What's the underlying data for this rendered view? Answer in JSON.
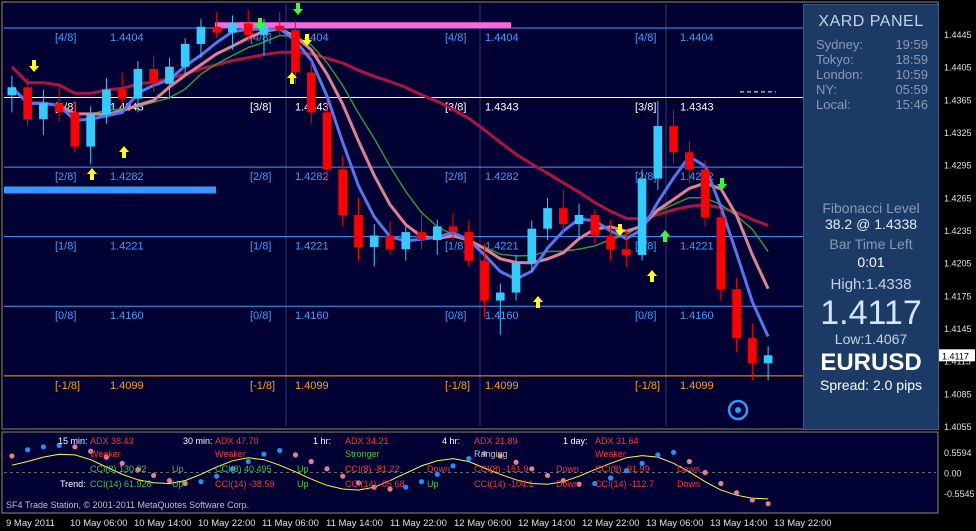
{
  "chart_data": {
    "type": "candlestick",
    "symbol": "EURUSD",
    "ylim": [
      1.4055,
      1.4425
    ],
    "y_ticks": [
      "1.4445",
      "1.4405",
      "1.4365",
      "1.4325",
      "1.4295",
      "1.4265",
      "1.4235",
      "1.4205",
      "1.4175",
      "1.4145",
      "1.4115",
      "1.4085",
      "1.4055"
    ],
    "current_price_label": "1.4117",
    "x_labels": [
      "9 May 2011",
      "10 May 06:00",
      "10 May 14:00",
      "10 May 22:00",
      "11 May 06:00",
      "11 May 14:00",
      "11 May 22:00",
      "12 May 06:00",
      "12 May 14:00",
      "12 May 22:00",
      "13 May 06:00",
      "13 May 14:00",
      "13 May 22:00"
    ],
    "murrey_levels": [
      {
        "name": "[4/8]",
        "value": 1.4404,
        "label": "1.4404",
        "color": "#3aa0ff"
      },
      {
        "name": "[3/8]",
        "value": 1.4343,
        "label": "1.4343",
        "color": "#ffffff"
      },
      {
        "name": "[2/8]",
        "value": 1.4282,
        "label": "1.4282",
        "color": "#3aa0ff"
      },
      {
        "name": "[1/8]",
        "value": 1.4221,
        "label": "1.4221",
        "color": "#3aa0ff"
      },
      {
        "name": "[0/8]",
        "value": 1.416,
        "label": "1.4160",
        "color": "#3aa0ff"
      },
      {
        "name": "[-1/8]",
        "value": 1.4099,
        "label": "1.4099",
        "color": "#ffa500"
      }
    ],
    "candles_ohlc": [
      [
        1.4345,
        1.4362,
        1.433,
        1.4352
      ],
      [
        1.4352,
        1.436,
        1.4318,
        1.4324
      ],
      [
        1.4324,
        1.435,
        1.431,
        1.4338
      ],
      [
        1.4338,
        1.4355,
        1.4322,
        1.433
      ],
      [
        1.433,
        1.434,
        1.4295,
        1.43
      ],
      [
        1.43,
        1.4335,
        1.4285,
        1.4328
      ],
      [
        1.4328,
        1.436,
        1.432,
        1.435
      ],
      [
        1.435,
        1.4365,
        1.4335,
        1.4342
      ],
      [
        1.4342,
        1.4375,
        1.433,
        1.4368
      ],
      [
        1.4368,
        1.438,
        1.4348,
        1.4355
      ],
      [
        1.4355,
        1.4378,
        1.4342,
        1.437
      ],
      [
        1.437,
        1.4395,
        1.4362,
        1.439
      ],
      [
        1.439,
        1.4412,
        1.4378,
        1.4405
      ],
      [
        1.4405,
        1.4418,
        1.4395,
        1.44
      ],
      [
        1.44,
        1.4415,
        1.4385,
        1.4408
      ],
      [
        1.4408,
        1.442,
        1.4392,
        1.4398
      ],
      [
        1.4398,
        1.4412,
        1.438,
        1.4406
      ],
      [
        1.4406,
        1.4418,
        1.4396,
        1.4402
      ],
      [
        1.4402,
        1.441,
        1.4355,
        1.4365
      ],
      [
        1.4365,
        1.4375,
        1.432,
        1.433
      ],
      [
        1.433,
        1.434,
        1.427,
        1.428
      ],
      [
        1.428,
        1.4292,
        1.423,
        1.424
      ],
      [
        1.424,
        1.4255,
        1.42,
        1.4212
      ],
      [
        1.4212,
        1.4232,
        1.4195,
        1.4222
      ],
      [
        1.4222,
        1.4235,
        1.4205,
        1.421
      ],
      [
        1.421,
        1.423,
        1.42,
        1.4225
      ],
      [
        1.4225,
        1.424,
        1.421,
        1.4218
      ],
      [
        1.4218,
        1.4236,
        1.4205,
        1.423
      ],
      [
        1.423,
        1.4242,
        1.4218,
        1.4225
      ],
      [
        1.4225,
        1.4235,
        1.4195,
        1.42
      ],
      [
        1.42,
        1.4215,
        1.415,
        1.4165
      ],
      [
        1.4165,
        1.418,
        1.4135,
        1.4172
      ],
      [
        1.4172,
        1.4205,
        1.4165,
        1.4198
      ],
      [
        1.4198,
        1.4235,
        1.419,
        1.4228
      ],
      [
        1.4228,
        1.4255,
        1.4218,
        1.4246
      ],
      [
        1.4246,
        1.4262,
        1.4225,
        1.4232
      ],
      [
        1.4232,
        1.425,
        1.4218,
        1.424
      ],
      [
        1.424,
        1.4245,
        1.4215,
        1.4222
      ],
      [
        1.4222,
        1.4236,
        1.42,
        1.421
      ],
      [
        1.421,
        1.4228,
        1.4195,
        1.4205
      ],
      [
        1.4205,
        1.428,
        1.42,
        1.4272
      ],
      [
        1.4272,
        1.434,
        1.4262,
        1.4318
      ],
      [
        1.4318,
        1.4332,
        1.4285,
        1.4295
      ],
      [
        1.4295,
        1.4305,
        1.4268,
        1.428
      ],
      [
        1.428,
        1.4288,
        1.423,
        1.4238
      ],
      [
        1.4238,
        1.4245,
        1.4165,
        1.4175
      ],
      [
        1.4175,
        1.4185,
        1.412,
        1.4132
      ],
      [
        1.4132,
        1.4145,
        1.4095,
        1.411
      ],
      [
        1.411,
        1.4125,
        1.4095,
        1.4117
      ]
    ],
    "indicator_panel": {
      "ylim": [
        -1.05,
        1.05
      ],
      "y_ticks": [
        "0.5594",
        "0.00",
        "-0.5545"
      ],
      "dots_values": [
        0.45,
        0.62,
        0.7,
        0.74,
        0.7,
        0.58,
        0.42,
        0.25,
        0.08,
        -0.08,
        -0.22,
        -0.3,
        -0.25,
        -0.1,
        0.1,
        0.3,
        0.5,
        0.6,
        0.48,
        0.3,
        0.1,
        -0.1,
        -0.28,
        -0.4,
        -0.45,
        -0.4,
        -0.25,
        -0.05,
        0.18,
        0.38,
        0.52,
        0.45,
        0.28,
        0.1,
        -0.08,
        -0.22,
        -0.32,
        -0.3,
        -0.15,
        0.05,
        0.25,
        0.48,
        0.55,
        0.3,
        0.0,
        -0.3,
        -0.55,
        -0.75,
        -0.85
      ],
      "line_values": [
        0.2,
        0.3,
        0.42,
        0.5,
        0.48,
        0.35,
        0.15,
        -0.05,
        -0.2,
        -0.28,
        -0.3,
        -0.22,
        -0.05,
        0.15,
        0.32,
        0.4,
        0.35,
        0.2,
        0.02,
        -0.18,
        -0.35,
        -0.45,
        -0.48,
        -0.4,
        -0.22,
        -0.02,
        0.18,
        0.32,
        0.38,
        0.3,
        0.12,
        -0.05,
        -0.2,
        -0.3,
        -0.32,
        -0.25,
        -0.1,
        0.08,
        0.25,
        0.4,
        0.46,
        0.42,
        0.25,
        0.02,
        -0.25,
        -0.48,
        -0.62,
        -0.7,
        -0.72
      ]
    }
  },
  "overlay_labels": {
    "tf": [
      {
        "tf": "15 min:",
        "adx": "ADX 38.43",
        "cci8": "CCI(8) 130.02",
        "cci8_dir": "Up",
        "cci14": "CCI(14) 61.928",
        "cci14_dir": "Up",
        "trend": "Trend:",
        "str": "Weaker"
      },
      {
        "tf": "30 min:",
        "adx": "ADX 47.70",
        "cci8": "CCI(8) 40.495",
        "cci8_dir": "Up",
        "cci14": "CCI(14) -38.59",
        "cci14_dir": "Up",
        "str": "Weaker"
      },
      {
        "tf": "1 hr:",
        "adx": "ADX 34.21",
        "cci8": "CCI(8) -81.22",
        "cci8_dir": "Down",
        "cci14": "CCI(14) -85.68",
        "cci14_dir": "Up",
        "str": "Stronger"
      },
      {
        "tf": "4 hr:",
        "adx": "ADX 21.89",
        "cci8": "CCI(8) -151.9",
        "cci8_dir": "Down",
        "cci14": "CCI(14) -104.1",
        "cci14_dir": "Down",
        "str": "Ranging"
      },
      {
        "tf": "1 day:",
        "adx": "ADX 31.64",
        "cci8": "CCI(8) -91.99",
        "cci8_dir": "Down",
        "cci14": "CCI(14) -112.7",
        "cci14_dir": "Down",
        "str": "Weaker"
      }
    ],
    "copyright": "SF4 Trade Station, © 2001-2011 MetaQuotes Software Corp."
  },
  "panel": {
    "title": "XARD PANEL",
    "sessions": [
      {
        "name": "Sydney:",
        "time": "19:59"
      },
      {
        "name": "Tokyo:",
        "time": "18:59"
      },
      {
        "name": "London:",
        "time": "10:59"
      },
      {
        "name": "NY:",
        "time": "05:59"
      },
      {
        "name": "Local:",
        "time": "15:46"
      }
    ],
    "fib_label": "Fibonacci Level",
    "fib_value": "38.2 @ 1.4338",
    "bar_time_label": "Bar Time Left",
    "bar_time_value": "0:01",
    "high": "High:1.4338",
    "price": "1.4117",
    "low": "Low:1.4067",
    "symbol": "EURUSD",
    "spread": "Spread: 2.0 pips"
  },
  "colors": {
    "background": "#000000",
    "main_bg": "#000033",
    "bull": "#33ccff",
    "bear": "#ff0000",
    "ma_fast": "#5577ee",
    "ma_slow": "#e08090",
    "ma_long": "#b0133f",
    "panel_bg": "#1c3a66",
    "dots_up": "#1e90ff",
    "dots_down": "#e08090"
  }
}
